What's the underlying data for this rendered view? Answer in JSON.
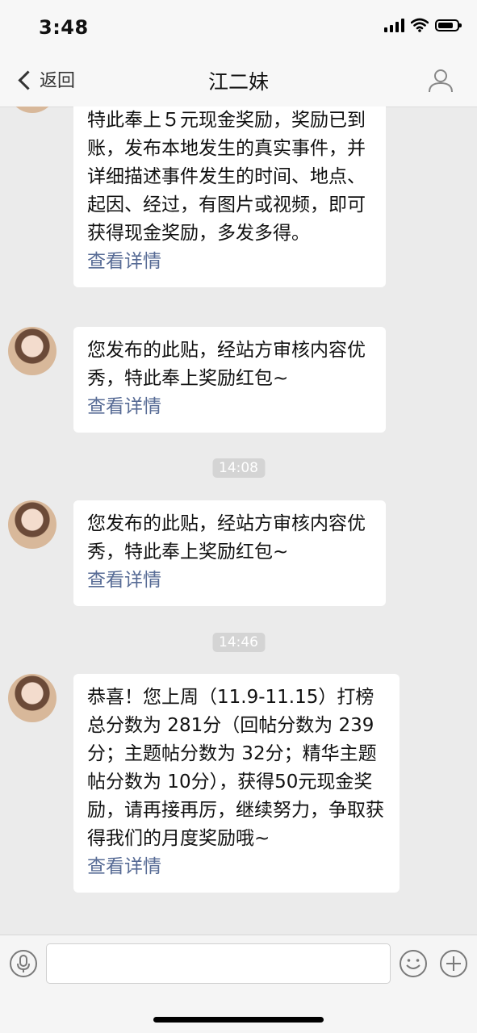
{
  "status_bar": {
    "time": "3:48"
  },
  "nav": {
    "back_label": "返回",
    "title": "江二妹"
  },
  "messages": [
    {
      "text": "特此奉上５元现金奖励，奖励已到账，发布本地发生的真实事件，并详细描述事件发生的时间、地点、起因、经过，有图片或视频，即可获得现金奖励，多发多得。",
      "link": "查看详情"
    },
    {
      "text": "您发布的此贴，经站方审核内容优秀，特此奉上奖励红包~",
      "link": "查看详情"
    },
    {
      "timestamp": "14:08"
    },
    {
      "text": "您发布的此贴，经站方审核内容优秀，特此奉上奖励红包~",
      "link": "查看详情"
    },
    {
      "timestamp": "14:46"
    },
    {
      "text": "恭喜！您上周（11.9-11.15）打榜总分数为 281分（回帖分数为 239分；主题帖分数为 32分；精华主题帖分数为 10分），获得50元现金奖励，请再接再厉，继续努力，争取获得我们的月度奖励哦~",
      "link": "查看详情"
    }
  ],
  "input_bar": {
    "placeholder": "",
    "value": ""
  },
  "icons": [
    "back-chevron-icon",
    "person-icon",
    "microphone-icon",
    "emoji-icon",
    "plus-icon"
  ]
}
